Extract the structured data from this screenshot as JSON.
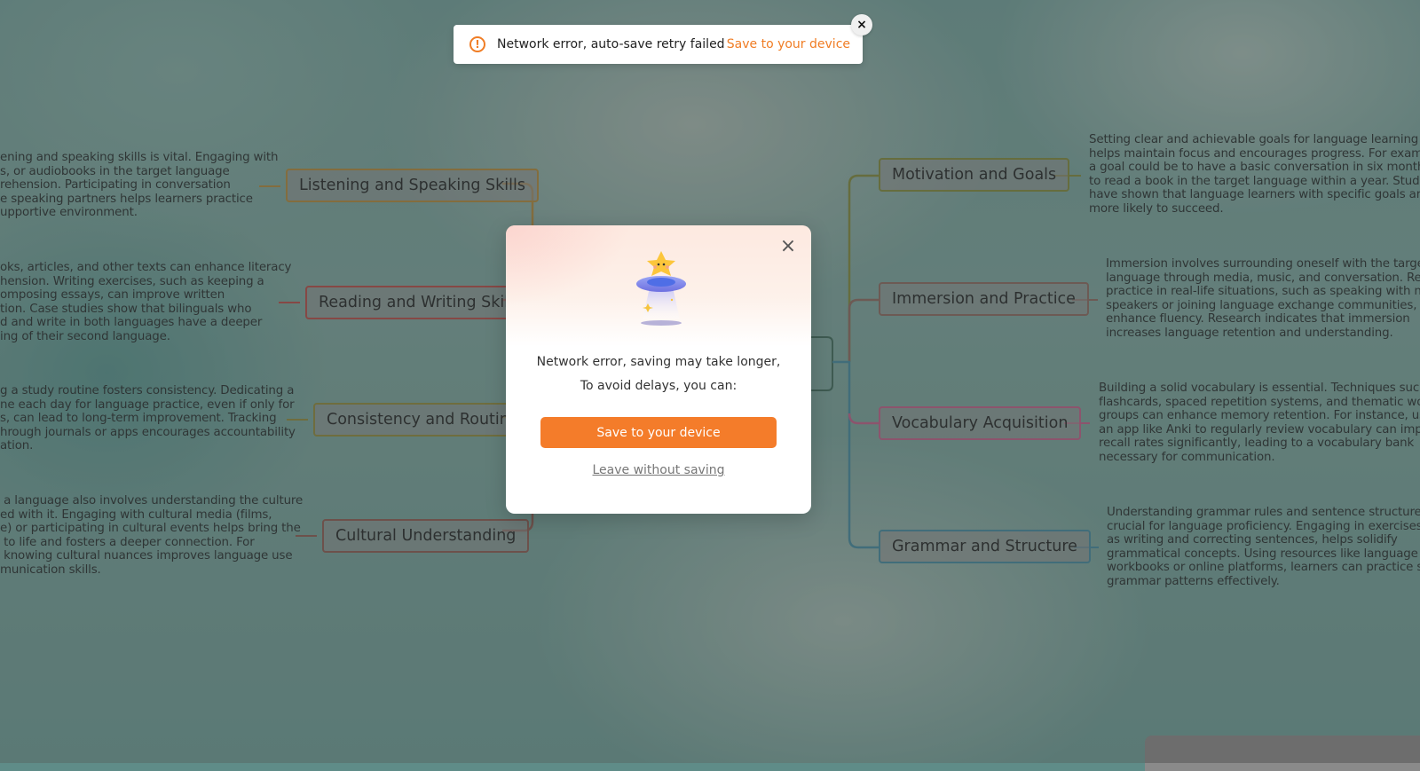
{
  "toast": {
    "icon": "warning-circle-icon",
    "message": "Network error, auto-save retry failed",
    "action": "Save to your device",
    "close": "×"
  },
  "modal": {
    "close": "×",
    "line1": "Network error, saving may take longer,",
    "line2": "To avoid delays, you can:",
    "primary_button": "Save to your device",
    "secondary_link": "Leave without saving"
  },
  "colors": {
    "accent": "#f47c2a",
    "branch_listening": "#b08a3a",
    "branch_reading": "#b54a46",
    "branch_consistency": "#8e8a3a",
    "branch_cultural": "#8a5a50",
    "branch_motivation": "#7f8a3a",
    "branch_immersion": "#8a6a60",
    "branch_vocabulary": "#c0608a",
    "branch_grammar": "#3f8aa0"
  },
  "mindmap": {
    "left": [
      {
        "topic": "Listening and Speaking Skills",
        "description": "ening and speaking skills is vital. Engaging with\ns, or audiobooks in the target language\nrehension. Participating in conversation\ne speaking partners helps learners practice\nupportive environment."
      },
      {
        "topic": "Reading and Writing Skills",
        "description": "oks, articles, and other texts can enhance literacy\nhension. Writing exercises, such as keeping a\nomposing essays, can improve written\ntion. Case studies show that bilinguals who\nd and write in both languages have a deeper\ning of their second language."
      },
      {
        "topic": "Consistency and Routine",
        "description": "g a study routine fosters consistency. Dedicating a\nne each day for language practice, even if only for\ns, can lead to long-term improvement. Tracking\nhrough journals or apps encourages accountability\nation."
      },
      {
        "topic": "Cultural Understanding",
        "description": " a language also involves understanding the culture\ned with it. Engaging with cultural media (films,\ne) or participating in cultural events helps bring the\n to life and fosters a deeper connection. For\n knowing cultural nuances improves language use\nmunication skills."
      }
    ],
    "right": [
      {
        "topic": "Motivation and Goals",
        "description": "Setting clear and achievable goals for language learning\nhelps maintain focus and encourages progress. For example\na goal could be to have a basic conversation in six months or\nto read a book in the target language within a year. Studies\nhave shown that language learners with specific goals are\nmore likely to succeed."
      },
      {
        "topic": "Immersion and Practice",
        "description": "Immersion involves surrounding oneself with the target\nlanguage through media, music, and conversation. Regular\npractice in real-life situations, such as speaking with native\nspeakers or joining language exchange communities, can\nenhance fluency. Research indicates that immersion\nincreases language retention and understanding."
      },
      {
        "topic": "Vocabulary Acquisition",
        "description": "Building a solid vocabulary is essential. Techniques such as\nflashcards, spaced repetition systems, and thematic word\ngroups can enhance memory retention. For instance, using\nan app like Anki to regularly review vocabulary can improve\nrecall rates significantly, leading to a vocabulary bank\nnecessary for communication."
      },
      {
        "topic": "Grammar and Structure",
        "description": "Understanding grammar rules and sentence structure is\ncrucial for language proficiency. Engaging in exercises, such\nas writing and correcting sentences, helps solidify\ngrammatical concepts. Using resources like language\nworkbooks or online platforms, learners can practice specific\ngrammar patterns effectively."
      }
    ]
  }
}
